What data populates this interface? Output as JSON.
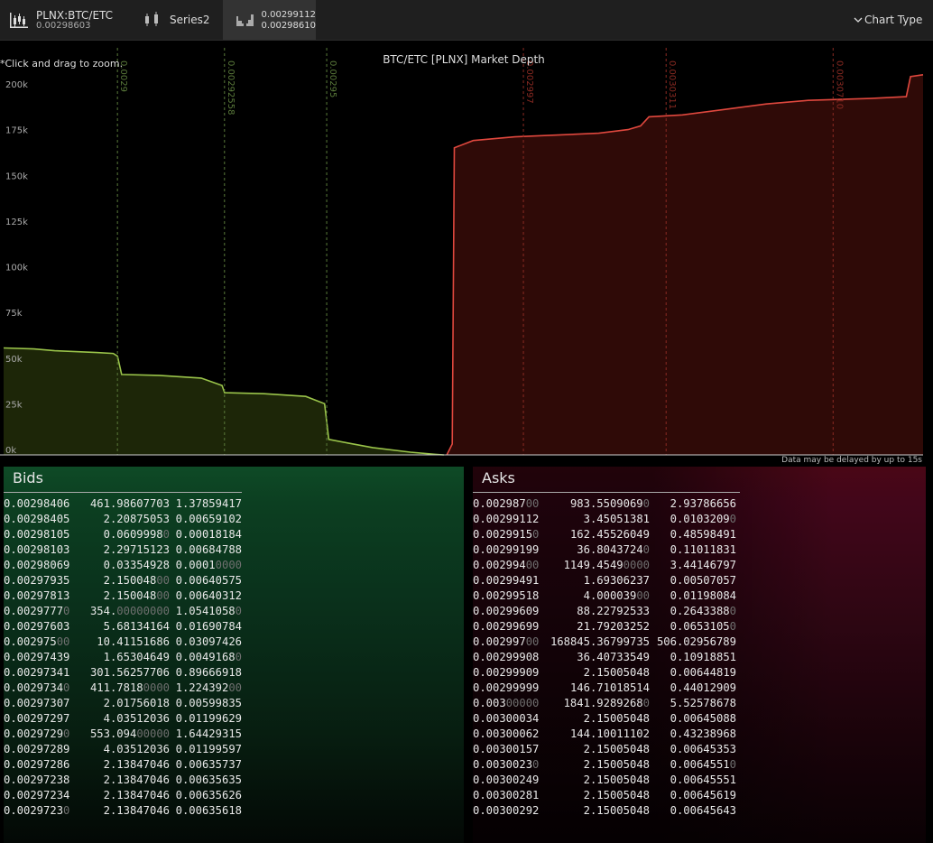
{
  "topbar": {
    "series1_title": "PLNX:BTC/ETC",
    "series1_value": "0.00298603",
    "series2_title": "Series2",
    "series3_line1": "0.00299112",
    "series3_line2": "0.00298610",
    "chart_type_label": "Chart Type"
  },
  "chart": {
    "zoom_hint": "*Click and drag to zoom.",
    "delay_note": "Data may be delayed by up to 15s",
    "colors": {
      "bid_line": "#9ac44a",
      "bid_fill": "#1d2608",
      "ask_line": "#e0483e",
      "ask_fill": "#2f0a07",
      "bid_marker": "#5a7a3a",
      "ask_marker": "#8a2a22"
    }
  },
  "chart_data": {
    "type": "area",
    "title": "BTC/ETC [PLNX] Market Depth",
    "ylim": [
      0,
      210000
    ],
    "yticks": [
      0,
      25000,
      50000,
      75000,
      100000,
      125000,
      150000,
      175000,
      200000
    ],
    "ytick_labels": [
      "0k",
      "25k",
      "50k",
      "75k",
      "100k",
      "125k",
      "150k",
      "175k",
      "200k"
    ],
    "xlim": [
      0.0028728,
      0.0030925
    ],
    "marker_lines": [
      {
        "price": 0.0029,
        "label": "0.0029",
        "side": "bid"
      },
      {
        "price": 0.00292558,
        "label": "0.00292558",
        "side": "bid"
      },
      {
        "price": 0.00295,
        "label": "0.00295",
        "side": "bid"
      },
      {
        "price": 0.002997,
        "label": "0.002997",
        "side": "ask"
      },
      {
        "price": 0.0030311,
        "label": "0.0030311",
        "side": "ask"
      },
      {
        "price": 0.003071,
        "label": "0.0030710",
        "side": "ask"
      }
    ],
    "series": [
      {
        "name": "Bids",
        "points": [
          [
            0.0028728,
            58500
          ],
          [
            0.00288,
            58000
          ],
          [
            0.002885,
            57000
          ],
          [
            0.002895,
            56000
          ],
          [
            0.002899,
            55500
          ],
          [
            0.0029,
            54000
          ],
          [
            0.002901,
            44000
          ],
          [
            0.00291,
            43500
          ],
          [
            0.00292,
            42000
          ],
          [
            0.002925,
            38000
          ],
          [
            0.0029256,
            34000
          ],
          [
            0.002935,
            33500
          ],
          [
            0.002945,
            32000
          ],
          [
            0.0029495,
            28000
          ],
          [
            0.0029505,
            8500
          ],
          [
            0.002955,
            6500
          ],
          [
            0.002961,
            4000
          ],
          [
            0.00297,
            1500
          ],
          [
            0.002976,
            300
          ],
          [
            0.002978,
            0
          ]
        ]
      },
      {
        "name": "Asks",
        "points": [
          [
            0.0029787,
            0
          ],
          [
            0.00298,
            6000
          ],
          [
            0.0029805,
            168000
          ],
          [
            0.002985,
            172000
          ],
          [
            0.002995,
            174000
          ],
          [
            0.003015,
            176000
          ],
          [
            0.003022,
            178000
          ],
          [
            0.003025,
            180000
          ],
          [
            0.003027,
            185000
          ],
          [
            0.003035,
            186000
          ],
          [
            0.003045,
            189000
          ],
          [
            0.003055,
            192000
          ],
          [
            0.003065,
            194000
          ],
          [
            0.00308,
            195000
          ],
          [
            0.0030885,
            196000
          ],
          [
            0.0030895,
            207000
          ],
          [
            0.0030925,
            208000
          ]
        ]
      }
    ]
  },
  "bids": {
    "title": "Bids",
    "rows": [
      {
        "price": "0.00298406",
        "price_dim": "",
        "amount": "461.98607703",
        "amount_dim": "",
        "total": "1.37859417",
        "total_dim": ""
      },
      {
        "price": "0.00298405",
        "price_dim": "",
        "amount": "2.20875053",
        "amount_dim": "",
        "total": "0.00659102",
        "total_dim": ""
      },
      {
        "price": "0.00298105",
        "price_dim": "",
        "amount": "0.0609998",
        "amount_dim": "0",
        "total": "0.00018184",
        "total_dim": ""
      },
      {
        "price": "0.00298103",
        "price_dim": "",
        "amount": "2.29715123",
        "amount_dim": "",
        "total": "0.00684788",
        "total_dim": ""
      },
      {
        "price": "0.00298069",
        "price_dim": "",
        "amount": "0.03354928",
        "amount_dim": "",
        "total": "0.0001",
        "total_dim": "0000"
      },
      {
        "price": "0.00297935",
        "price_dim": "",
        "amount": "2.150048",
        "amount_dim": "00",
        "total": "0.00640575",
        "total_dim": ""
      },
      {
        "price": "0.00297813",
        "price_dim": "",
        "amount": "2.150048",
        "amount_dim": "00",
        "total": "0.00640312",
        "total_dim": ""
      },
      {
        "price": "0.0029777",
        "price_dim": "0",
        "amount": "354.",
        "amount_dim": "00000000",
        "total": "1.0541058",
        "total_dim": "0"
      },
      {
        "price": "0.00297603",
        "price_dim": "",
        "amount": "5.68134164",
        "amount_dim": "",
        "total": "0.01690784",
        "total_dim": ""
      },
      {
        "price": "0.002975",
        "price_dim": "00",
        "amount": "10.41151686",
        "amount_dim": "",
        "total": "0.03097426",
        "total_dim": ""
      },
      {
        "price": "0.00297439",
        "price_dim": "",
        "amount": "1.65304649",
        "amount_dim": "",
        "total": "0.0049168",
        "total_dim": "0"
      },
      {
        "price": "0.00297341",
        "price_dim": "",
        "amount": "301.56257706",
        "amount_dim": "",
        "total": "0.89666918",
        "total_dim": ""
      },
      {
        "price": "0.0029734",
        "price_dim": "0",
        "amount": "411.7818",
        "amount_dim": "0000",
        "total": "1.224392",
        "total_dim": "00"
      },
      {
        "price": "0.00297307",
        "price_dim": "",
        "amount": "2.01756018",
        "amount_dim": "",
        "total": "0.00599835",
        "total_dim": ""
      },
      {
        "price": "0.00297297",
        "price_dim": "",
        "amount": "4.03512036",
        "amount_dim": "",
        "total": "0.01199629",
        "total_dim": ""
      },
      {
        "price": "0.0029729",
        "price_dim": "0",
        "amount": "553.094",
        "amount_dim": "00000",
        "total": "1.64429315",
        "total_dim": ""
      },
      {
        "price": "0.00297289",
        "price_dim": "",
        "amount": "4.03512036",
        "amount_dim": "",
        "total": "0.01199597",
        "total_dim": ""
      },
      {
        "price": "0.00297286",
        "price_dim": "",
        "amount": "2.13847046",
        "amount_dim": "",
        "total": "0.00635737",
        "total_dim": ""
      },
      {
        "price": "0.00297238",
        "price_dim": "",
        "amount": "2.13847046",
        "amount_dim": "",
        "total": "0.00635635",
        "total_dim": ""
      },
      {
        "price": "0.00297234",
        "price_dim": "",
        "amount": "2.13847046",
        "amount_dim": "",
        "total": "0.00635626",
        "total_dim": ""
      },
      {
        "price": "0.0029723",
        "price_dim": "0",
        "amount": "2.13847046",
        "amount_dim": "",
        "total": "0.00635618",
        "total_dim": ""
      }
    ]
  },
  "asks": {
    "title": "Asks",
    "rows": [
      {
        "price": "0.002987",
        "price_dim": "00",
        "amount": "983.5509069",
        "amount_dim": "0",
        "total": "2.93786656",
        "total_dim": ""
      },
      {
        "price": "0.00299112",
        "price_dim": "",
        "amount": "3.45051381",
        "amount_dim": "",
        "total": "0.0103209",
        "total_dim": "0"
      },
      {
        "price": "0.0029915",
        "price_dim": "0",
        "amount": "162.45526049",
        "amount_dim": "",
        "total": "0.48598491",
        "total_dim": ""
      },
      {
        "price": "0.00299199",
        "price_dim": "",
        "amount": "36.8043724",
        "amount_dim": "0",
        "total": "0.11011831",
        "total_dim": ""
      },
      {
        "price": "0.002994",
        "price_dim": "00",
        "amount": "1149.4549",
        "amount_dim": "0000",
        "total": "3.44146797",
        "total_dim": ""
      },
      {
        "price": "0.00299491",
        "price_dim": "",
        "amount": "1.69306237",
        "amount_dim": "",
        "total": "0.00507057",
        "total_dim": ""
      },
      {
        "price": "0.00299518",
        "price_dim": "",
        "amount": "4.000039",
        "amount_dim": "00",
        "total": "0.01198084",
        "total_dim": ""
      },
      {
        "price": "0.00299609",
        "price_dim": "",
        "amount": "88.22792533",
        "amount_dim": "",
        "total": "0.2643388",
        "total_dim": "0"
      },
      {
        "price": "0.00299699",
        "price_dim": "",
        "amount": "21.79203252",
        "amount_dim": "",
        "total": "0.0653105",
        "total_dim": "0"
      },
      {
        "price": "0.002997",
        "price_dim": "00",
        "amount": "168845.36799735",
        "amount_dim": "",
        "total": "506.02956789",
        "total_dim": ""
      },
      {
        "price": "0.00299908",
        "price_dim": "",
        "amount": "36.40733549",
        "amount_dim": "",
        "total": "0.10918851",
        "total_dim": ""
      },
      {
        "price": "0.00299909",
        "price_dim": "",
        "amount": "2.15005048",
        "amount_dim": "",
        "total": "0.00644819",
        "total_dim": ""
      },
      {
        "price": "0.00299999",
        "price_dim": "",
        "amount": "146.71018514",
        "amount_dim": "",
        "total": "0.44012909",
        "total_dim": ""
      },
      {
        "price": "0.003",
        "price_dim": "00000",
        "amount": "1841.9289268",
        "amount_dim": "0",
        "total": "5.52578678",
        "total_dim": ""
      },
      {
        "price": "0.00300034",
        "price_dim": "",
        "amount": "2.15005048",
        "amount_dim": "",
        "total": "0.00645088",
        "total_dim": ""
      },
      {
        "price": "0.00300062",
        "price_dim": "",
        "amount": "144.10011102",
        "amount_dim": "",
        "total": "0.43238968",
        "total_dim": ""
      },
      {
        "price": "0.00300157",
        "price_dim": "",
        "amount": "2.15005048",
        "amount_dim": "",
        "total": "0.00645353",
        "total_dim": ""
      },
      {
        "price": "0.0030023",
        "price_dim": "0",
        "amount": "2.15005048",
        "amount_dim": "",
        "total": "0.0064551",
        "total_dim": "0"
      },
      {
        "price": "0.00300249",
        "price_dim": "",
        "amount": "2.15005048",
        "amount_dim": "",
        "total": "0.00645551",
        "total_dim": ""
      },
      {
        "price": "0.00300281",
        "price_dim": "",
        "amount": "2.15005048",
        "amount_dim": "",
        "total": "0.00645619",
        "total_dim": ""
      },
      {
        "price": "0.00300292",
        "price_dim": "",
        "amount": "2.15005048",
        "amount_dim": "",
        "total": "0.00645643",
        "total_dim": ""
      }
    ]
  }
}
